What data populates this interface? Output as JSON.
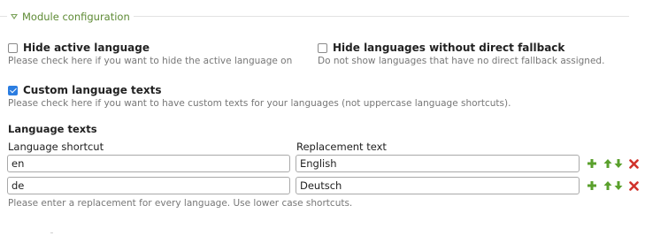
{
  "fieldset": {
    "legend": "Module configuration"
  },
  "options": {
    "hide_active": {
      "label": "Hide active language",
      "help": "Please check here if you want to hide the active language on",
      "checked": false
    },
    "hide_no_fallback": {
      "label": "Hide languages without direct fallback",
      "help": "Do not show languages that have no direct fallback assigned.",
      "checked": false
    },
    "custom_texts": {
      "label": "Custom language texts",
      "help": "Please check here if you want to have custom texts for your languages (not uppercase language shortcuts).",
      "checked": true
    }
  },
  "language_texts": {
    "title": "Language texts",
    "col_shortcut": "Language shortcut",
    "col_replacement": "Replacement text",
    "rows": [
      {
        "shortcut": "en",
        "replacement": "English"
      },
      {
        "shortcut": "de",
        "replacement": "Deutsch"
      }
    ],
    "help": "Please enter a replacement for every language. Use lower case shortcuts."
  },
  "icons": {
    "add": "plus-icon",
    "move_up": "arrow-up-icon",
    "move_down": "arrow-down-icon",
    "delete": "delete-icon"
  },
  "colors": {
    "legend": "#5d8a34",
    "checkbox_checked": "#2b7de1",
    "add_icon": "#5aa02c",
    "delete_icon": "#d0322b"
  }
}
